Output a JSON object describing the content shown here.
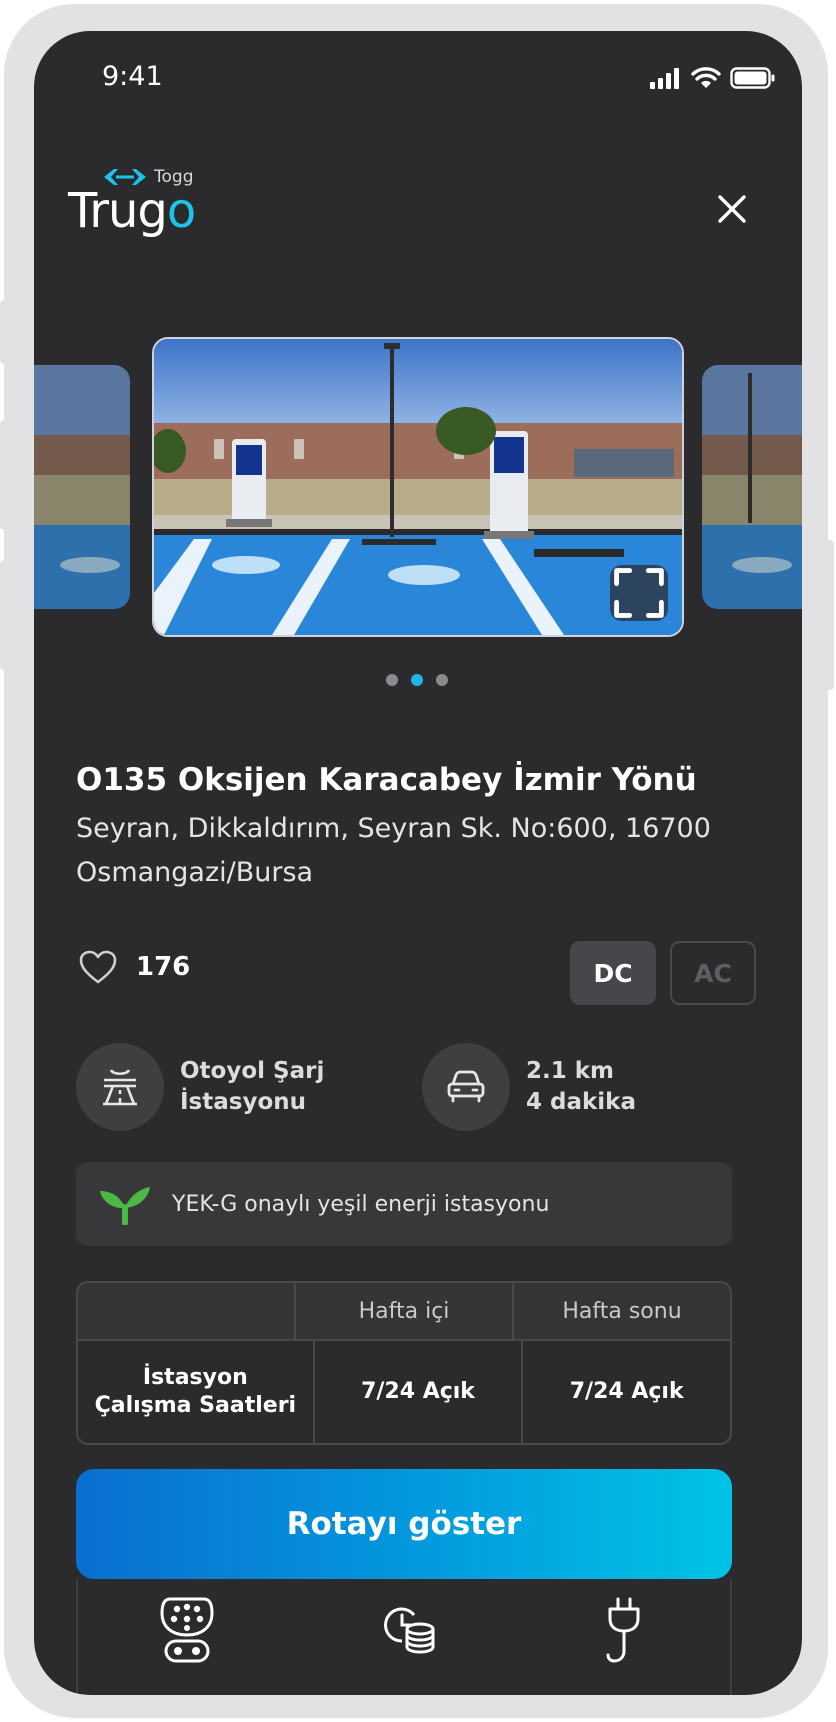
{
  "status_bar": {
    "time": "9:41"
  },
  "brand": {
    "small": "Togg",
    "name_main": "Trug",
    "name_accent": "o"
  },
  "gallery": {
    "total": 3,
    "active_index": 1
  },
  "station": {
    "title": "O135 Oksijen Karacabey İzmir Yönü",
    "address": "Seyran, Dikkaldırım, Seyran Sk. No:600, 16700 Osmangazi/Bursa",
    "likes": "176",
    "charge_types": {
      "dc": "DC",
      "ac": "AC",
      "active": "DC"
    }
  },
  "info": {
    "type_line1": "Otoyol Şarj",
    "type_line2": "İstasyonu",
    "distance": "2.1 km",
    "duration": "4 dakika"
  },
  "green_banner": {
    "text": "YEK-G onaylı yeşil enerji istasyonu"
  },
  "hours_table": {
    "headers": [
      "",
      "Hafta içi",
      "Hafta sonu"
    ],
    "row_label": "İstasyon Çalışma Saatleri",
    "weekday": "7/24 Açık",
    "weekend": "7/24 Açık"
  },
  "cta": {
    "label": "Rotayı göster"
  },
  "colors": {
    "accent": "#1cc4ea",
    "background": "#2b2b2d",
    "green": "#4cb944"
  },
  "tabs": [
    "connector-icon",
    "time-cost-icon",
    "plug-icon"
  ]
}
